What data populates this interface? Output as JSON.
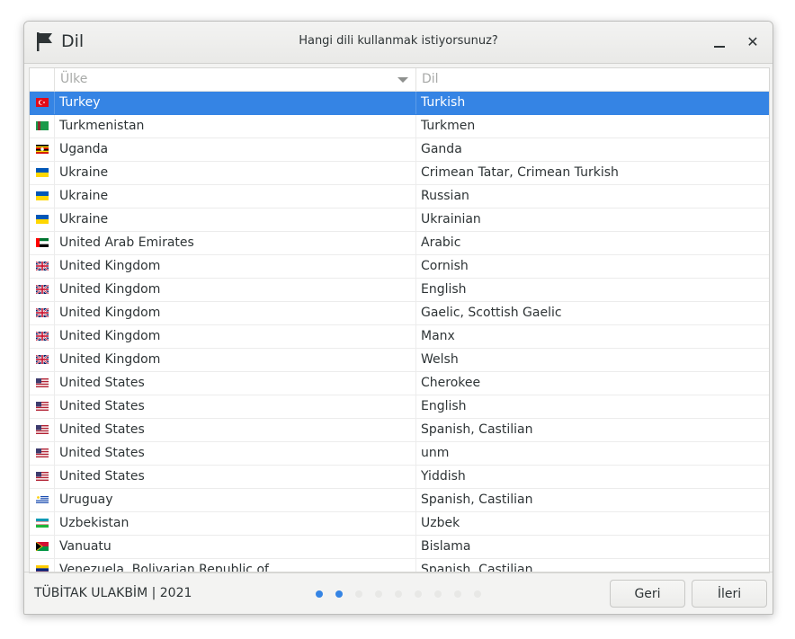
{
  "window": {
    "app_title": "Dil",
    "title": "Hangi dili kullanmak istiyorsunuz?",
    "app_icon": "flag-icon"
  },
  "table": {
    "columns": {
      "country": "Ülke",
      "language": "Dil"
    },
    "rows": [
      {
        "country": "Turkey",
        "language": "Turkish",
        "flag": "turkey",
        "selected": true
      },
      {
        "country": "Turkmenistan",
        "language": "Turkmen",
        "flag": "turkmenistan"
      },
      {
        "country": "Uganda",
        "language": "Ganda",
        "flag": "uganda"
      },
      {
        "country": "Ukraine",
        "language": "Crimean Tatar, Crimean Turkish",
        "flag": "ukraine"
      },
      {
        "country": "Ukraine",
        "language": "Russian",
        "flag": "ukraine"
      },
      {
        "country": "Ukraine",
        "language": "Ukrainian",
        "flag": "ukraine"
      },
      {
        "country": "United Arab Emirates",
        "language": "Arabic",
        "flag": "uae"
      },
      {
        "country": "United Kingdom",
        "language": "Cornish",
        "flag": "uk"
      },
      {
        "country": "United Kingdom",
        "language": "English",
        "flag": "uk"
      },
      {
        "country": "United Kingdom",
        "language": "Gaelic, Scottish Gaelic",
        "flag": "uk"
      },
      {
        "country": "United Kingdom",
        "language": "Manx",
        "flag": "uk"
      },
      {
        "country": "United Kingdom",
        "language": "Welsh",
        "flag": "uk"
      },
      {
        "country": "United States",
        "language": "Cherokee",
        "flag": "us"
      },
      {
        "country": "United States",
        "language": "English",
        "flag": "us"
      },
      {
        "country": "United States",
        "language": "Spanish, Castilian",
        "flag": "us"
      },
      {
        "country": "United States",
        "language": "unm",
        "flag": "us"
      },
      {
        "country": "United States",
        "language": "Yiddish",
        "flag": "us"
      },
      {
        "country": "Uruguay",
        "language": "Spanish, Castilian",
        "flag": "uruguay"
      },
      {
        "country": "Uzbekistan",
        "language": "Uzbek",
        "flag": "uzbekistan"
      },
      {
        "country": "Vanuatu",
        "language": "Bislama",
        "flag": "vanuatu"
      },
      {
        "country": "Venezuela, Bolivarian Republic of",
        "language": "Spanish, Castilian",
        "flag": "venezuela"
      }
    ]
  },
  "footer": {
    "org_text": "TÜBİTAK ULAKBİM | 2021",
    "steps_total": 9,
    "steps_active": 2,
    "back_label": "Geri",
    "next_label": "İleri"
  },
  "colors": {
    "accent": "#3584e4"
  }
}
